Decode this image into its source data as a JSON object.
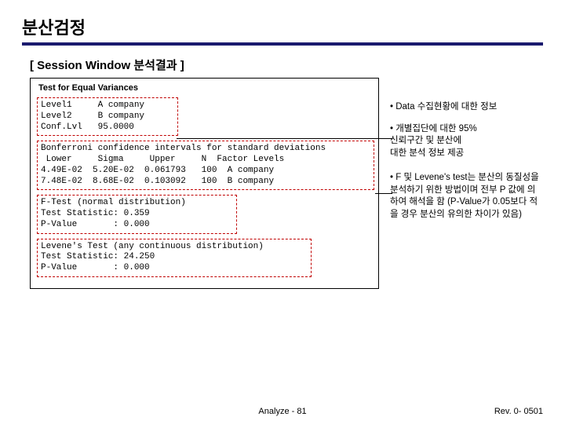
{
  "title": "분산검정",
  "subheader": "[ Session Window 분석결과 ]",
  "session": {
    "heading": "Test for Equal Variances",
    "block1": "Level1     A company\nLevel2     B company\nConf.Lvl   95.0000",
    "block2": "Bonferroni confidence intervals for standard deviations\n Lower     Sigma     Upper     N  Factor Levels\n4.49E-02  5.20E-02  0.061793   100  A company\n7.48E-02  8.68E-02  0.103092   100  B company",
    "block3": "F-Test (normal distribution)\nTest Statistic: 0.359\nP-Value       : 0.000",
    "block4": "Levene's Test (any continuous distribution)\nTest Statistic: 24.250\nP-Value       : 0.000"
  },
  "notes": {
    "n1": "• Data 수집현황에 대한 정보",
    "n2": "• 개별집단에 대한 95%\n  신뢰구간 및 분산에\n  대한 분석 정보 제공",
    "n3": "• F 및 Levene's test는 분산의 동질성을 분석하기 위한 방법이며 전부 P 값에 의하여 해석을 함 (P-Value가 0.05보다 적을 경우 분산의 유의한 차이가 있음)"
  },
  "footer": {
    "center": "Analyze - 81",
    "right": "Rev. 0- 0501"
  }
}
